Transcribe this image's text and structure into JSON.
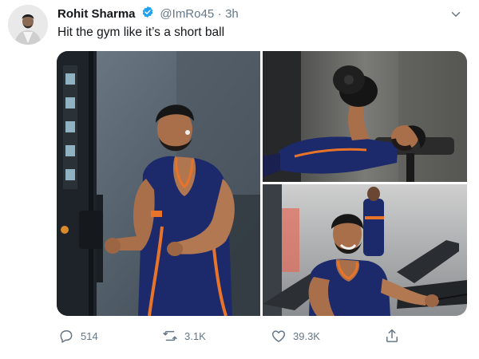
{
  "tweet": {
    "author_name": "Rohit Sharma",
    "handle": "@ImRo45",
    "separator": "·",
    "time": "3h",
    "text": "Hit the gym like it’s a short ball",
    "verified": true
  },
  "actions": {
    "replies": "514",
    "retweets": "3.1K",
    "likes": "39.3K"
  },
  "icons": {
    "verified": "verified-badge-icon",
    "menu": "chevron-down-icon",
    "reply": "comment-icon",
    "retweet": "retweet-icon",
    "like": "heart-icon",
    "share": "share-icon"
  },
  "colors": {
    "verified": "#1da1f2",
    "secondary_text": "#657786",
    "jersey_blue": "#1c2a6b",
    "jersey_orange": "#e8742a"
  }
}
